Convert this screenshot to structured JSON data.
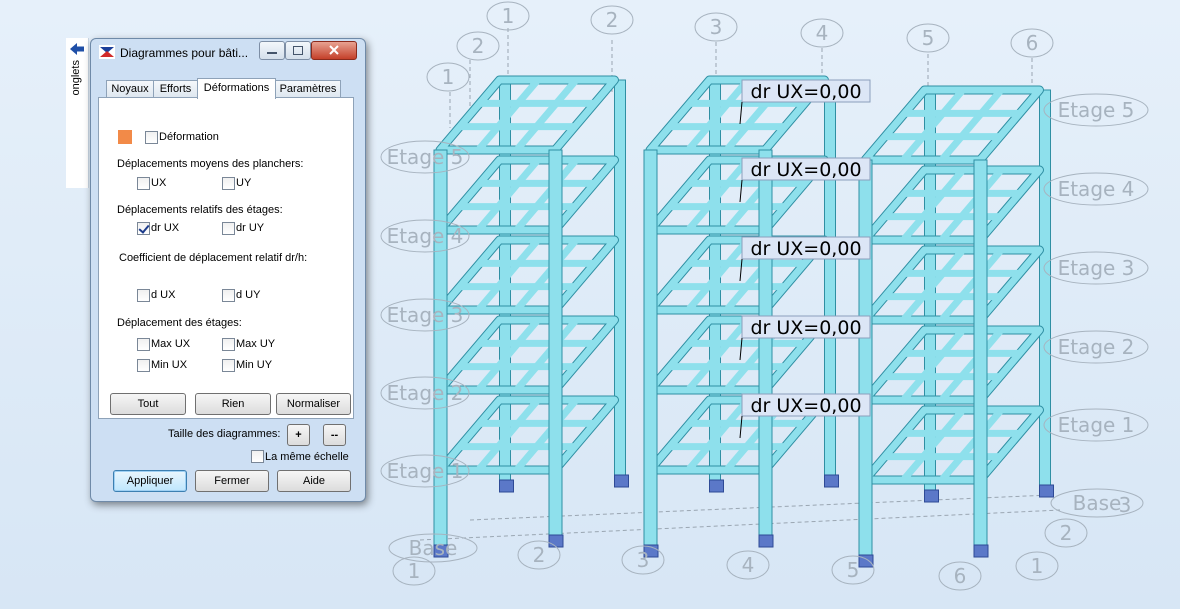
{
  "dialog": {
    "title": "Diagrammes pour bâti...",
    "tabs": [
      {
        "label": "Noyaux"
      },
      {
        "label": "Efforts"
      },
      {
        "label": "Déformations"
      },
      {
        "label": "Paramètres"
      }
    ],
    "active_tab": "Déformations",
    "deformation_label": "Déformation",
    "deformation_color": "#f28a48",
    "sections": {
      "moyens": {
        "title": "Déplacements moyens des planchers:",
        "ux": "UX",
        "uy": "UY"
      },
      "relatifs": {
        "title": "Déplacements relatifs des étages:",
        "drux": "dr UX",
        "druy": "dr UY"
      },
      "coefficient": {
        "title": "Coefficient de déplacement relatif dr/h:",
        "dux": "d UX",
        "duy": "d UY"
      },
      "etages": {
        "title": "Déplacement des étages:",
        "maxux": "Max UX",
        "maxuy": "Max UY",
        "minux": "Min UX",
        "minuy": "Min UY"
      }
    },
    "checked": {
      "drux": true
    },
    "buttons": {
      "tout": "Tout",
      "rien": "Rien",
      "normaliser": "Normaliser"
    },
    "taille_label": "Taille des diagrammes:",
    "plus": "+",
    "minus": "--",
    "meme_echelle": "La même échelle",
    "footer": {
      "appliquer": "Appliquer",
      "fermer": "Fermer",
      "aide": "Aide"
    }
  },
  "side_panel": {
    "label": "onglets"
  },
  "viewport": {
    "story_labels_left": [
      "Etage 5",
      "Etage 4",
      "Etage 3",
      "Etage 2",
      "Etage 1",
      "Base"
    ],
    "story_labels_right": [
      "Etage 5",
      "Etage 4",
      "Etage 3",
      "Etage 2",
      "Etage 1",
      "Base"
    ],
    "axis_base_right": "3",
    "results": [
      "dr UX=0,00",
      "dr UX=0,00",
      "dr UX=0,00",
      "dr UX=0,00",
      "dr UX=0,00"
    ],
    "top_grid_labels": [
      "1",
      "2",
      "1",
      "2",
      "3",
      "4",
      "5",
      "6"
    ],
    "bottom_grid_labels": [
      "1",
      "2",
      "3",
      "4",
      "5",
      "6",
      "1",
      "2"
    ],
    "colors": {
      "structure": "#8ee0ec",
      "structure_edge": "#2f8fa3",
      "support": "#5b78c8",
      "bubble": "#a7b3bf",
      "result_box": "#dce6f6"
    }
  }
}
